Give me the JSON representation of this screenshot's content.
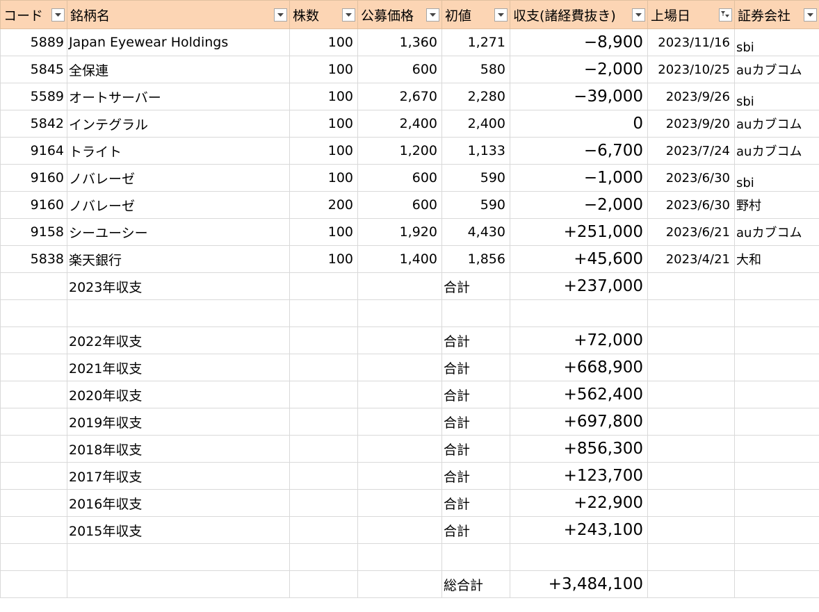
{
  "headers": [
    "コード",
    "銘柄名",
    "株数",
    "公募価格",
    "初値",
    "収支(諸経費抜き)",
    "上場日",
    "証券会社"
  ],
  "filtered_column_index": 6,
  "rows": [
    {
      "code": "5889",
      "name": "Japan Eyewear Holdings",
      "shares": "100",
      "ipo_price": "1,360",
      "first_price": "1,271",
      "pnl": "−8,900",
      "date": "2023/11/16",
      "broker": "sbi"
    },
    {
      "code": "5845",
      "name": "全保連",
      "shares": "100",
      "ipo_price": "600",
      "first_price": "580",
      "pnl": "−2,000",
      "date": "2023/10/25",
      "broker": "auカブコム"
    },
    {
      "code": "5589",
      "name": "オートサーバー",
      "shares": "100",
      "ipo_price": "2,670",
      "first_price": "2,280",
      "pnl": "−39,000",
      "date": "2023/9/26",
      "broker": "sbi"
    },
    {
      "code": "5842",
      "name": "インテグラル",
      "shares": "100",
      "ipo_price": "2,400",
      "first_price": "2,400",
      "pnl": "0",
      "date": "2023/9/20",
      "broker": "auカブコム"
    },
    {
      "code": "9164",
      "name": "トライト",
      "shares": "100",
      "ipo_price": "1,200",
      "first_price": "1,133",
      "pnl": "−6,700",
      "date": "2023/7/24",
      "broker": "auカブコム"
    },
    {
      "code": "9160",
      "name": "ノバレーゼ",
      "shares": "100",
      "ipo_price": "600",
      "first_price": "590",
      "pnl": "−1,000",
      "date": "2023/6/30",
      "broker": "sbi"
    },
    {
      "code": "9160",
      "name": "ノバレーゼ",
      "shares": "200",
      "ipo_price": "600",
      "first_price": "590",
      "pnl": "−2,000",
      "date": "2023/6/30",
      "broker": "野村"
    },
    {
      "code": "9158",
      "name": "シーユーシー",
      "shares": "100",
      "ipo_price": "1,920",
      "first_price": "4,430",
      "pnl": "+251,000",
      "date": "2023/6/21",
      "broker": "auカブコム"
    },
    {
      "code": "5838",
      "name": "楽天銀行",
      "shares": "100",
      "ipo_price": "1,400",
      "first_price": "1,856",
      "pnl": "+45,600",
      "date": "2023/4/21",
      "broker": "大和"
    }
  ],
  "year_2023": {
    "label": "2023年収支",
    "sum_label": "合計",
    "value": "+237,000"
  },
  "past_years": [
    {
      "label": "2022年収支",
      "sum_label": "合計",
      "value": "+72,000"
    },
    {
      "label": "2021年収支",
      "sum_label": "合計",
      "value": "+668,900"
    },
    {
      "label": "2020年収支",
      "sum_label": "合計",
      "value": "+562,400"
    },
    {
      "label": "2019年収支",
      "sum_label": "合計",
      "value": "+697,800"
    },
    {
      "label": "2018年収支",
      "sum_label": "合計",
      "value": "+856,300"
    },
    {
      "label": "2017年収支",
      "sum_label": "合計",
      "value": "+123,700"
    },
    {
      "label": "2016年収支",
      "sum_label": "合計",
      "value": "+22,900"
    },
    {
      "label": "2015年収支",
      "sum_label": "合計",
      "value": "+243,100"
    }
  ],
  "grand_total": {
    "label": "総合計",
    "value": "+3,484,100"
  },
  "icons": {
    "dropdown": "dropdown-arrow-icon",
    "filter_active": "filter-active-icon"
  },
  "colors": {
    "header_bg": "#fcd5b4",
    "grid": "#d9d9d9"
  }
}
